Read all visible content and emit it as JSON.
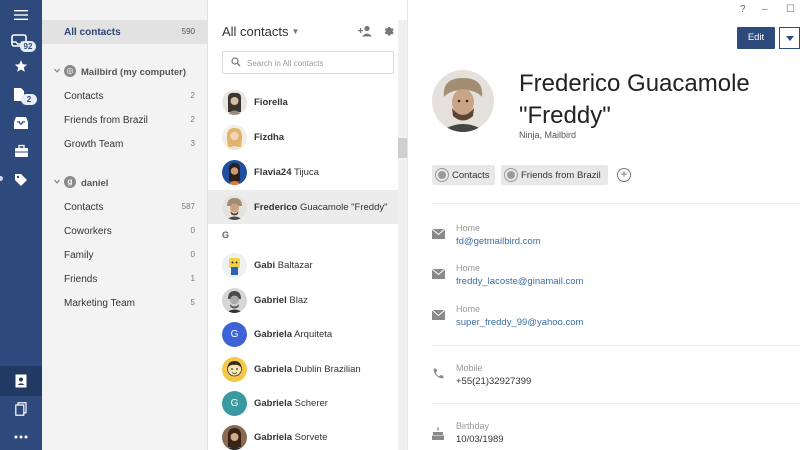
{
  "rail": {
    "badges": {
      "inbox": "92",
      "drafts": "2"
    }
  },
  "folders": {
    "all_contacts": {
      "label": "All contacts",
      "count": "590"
    },
    "accounts": [
      {
        "name": "Mailbird (my computer)",
        "groups": [
          {
            "label": "Contacts",
            "count": "2"
          },
          {
            "label": "Friends from Brazil",
            "count": "2"
          },
          {
            "label": "Growth Team",
            "count": "3"
          }
        ]
      },
      {
        "name": "daniel",
        "groups": [
          {
            "label": "Contacts",
            "count": "587"
          },
          {
            "label": "Coworkers",
            "count": "0"
          },
          {
            "label": "Family",
            "count": "0"
          },
          {
            "label": "Friends",
            "count": "1"
          },
          {
            "label": "Marketing Team",
            "count": "5"
          }
        ]
      }
    ]
  },
  "list": {
    "title": "All contacts",
    "search_placeholder": "Search in All contacts",
    "group_letter": "G",
    "contacts": [
      {
        "first": "Fiorella",
        "last": ""
      },
      {
        "first": "Fizdha",
        "last": ""
      },
      {
        "first": "Flavia24",
        "last": "Tijuca"
      },
      {
        "first": "Frederico",
        "last": "Guacamole \"Freddy\""
      },
      {
        "first": "Gabi",
        "last": "Baltazar"
      },
      {
        "first": "Gabriel",
        "last": "Blaz"
      },
      {
        "first": "Gabriela",
        "last": "Arquiteta",
        "initial": "G"
      },
      {
        "first": "Gabriela",
        "last": "Dublin Brazilian"
      },
      {
        "first": "Gabriela",
        "last": "Scherer",
        "initial": "G"
      },
      {
        "first": "Gabriela",
        "last": "Sorvete"
      }
    ]
  },
  "window": {
    "help": "?",
    "minimize": "–",
    "maximize": "☐"
  },
  "detail": {
    "edit_label": "Edit",
    "name_line1": "Frederico Guacamole",
    "name_line2": "\"Freddy\"",
    "subtitle": "Ninja, Mailbird",
    "tags": [
      "Contacts",
      "Friends from Brazil"
    ],
    "emails": [
      {
        "label": "Home",
        "value": "fd@getmailbird.com"
      },
      {
        "label": "Home",
        "value": "freddy_lacoste@ginamail.com"
      },
      {
        "label": "Home",
        "value": "super_freddy_99@yahoo.com"
      }
    ],
    "phone": {
      "label": "Mobile",
      "value": "+55(21)32927399"
    },
    "birthday": {
      "label": "Birthday",
      "value": "10/03/1989"
    }
  },
  "colors": {
    "accent": "#2e4a7d",
    "link": "#3a6ea5"
  }
}
